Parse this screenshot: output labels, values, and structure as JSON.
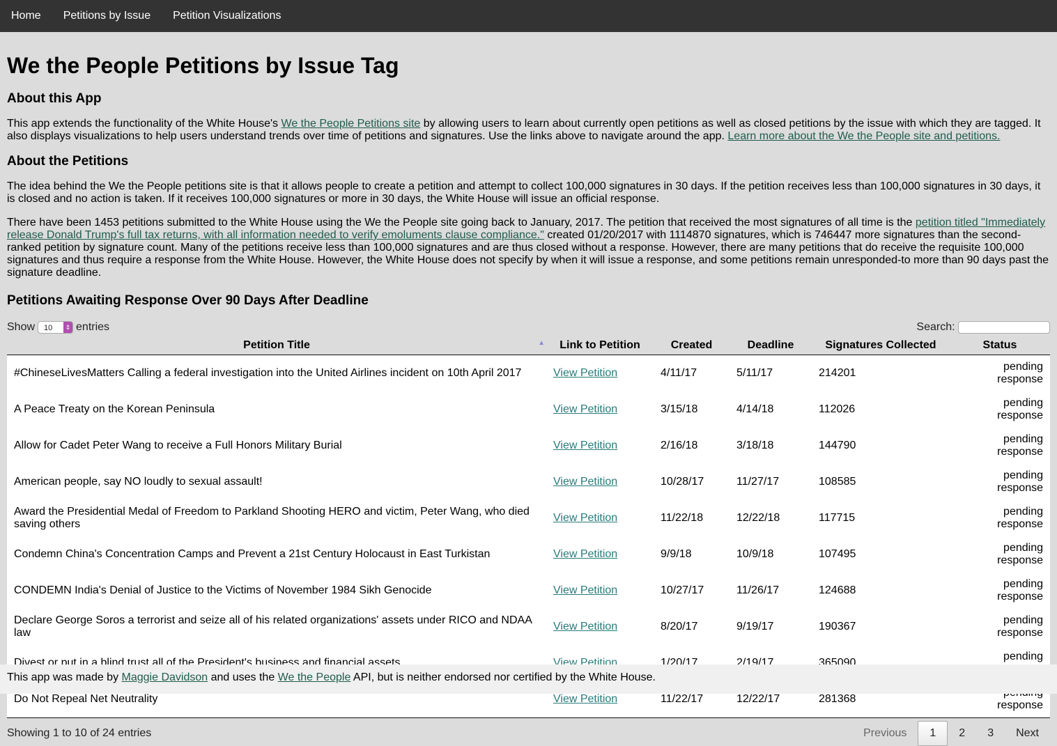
{
  "nav": [
    "Home",
    "Petitions by Issue",
    "Petition Visualizations"
  ],
  "title": "We the People Petitions by Issue Tag",
  "about_app": {
    "heading": "About this App",
    "t1": "This app extends the functionality of the White House's ",
    "link1": "We the People Petitions site",
    "t2": " by allowing users to learn about currently open petitions as well as closed petitions by the issue with which they are tagged. It also displays visualizations to help users understand trends over time of petitions and signatures. Use the links above to navigate around the app. ",
    "link2": "Learn more about the We the People site and petitions."
  },
  "about_petitions": {
    "heading": "About the Petitions",
    "p1": "The idea behind the We the People petitions site is that it allows people to create a petition and attempt to collect 100,000 signatures in 30 days. If the petition receives less than 100,000 signatures in 30 days, it is closed and no action is taken. If it receives 100,000 signatures or more in 30 days, the White House will issue an official response.",
    "p2a": "There have been 1453 petitions submitted to the White House using the We the People site going back to January, 2017. The petition that received the most signatures of all time is the ",
    "p2link": "petition titled \"Immediately release Donald Trump's full tax returns, with all information needed to verify emoluments clause compliance.\"",
    "p2b": " created 01/20/2017 with 1114870 signatures, which is 746447 more signatures than the second-ranked petition by signature count. Many of the petitions receive less than 100,000 signatures and are thus closed without a response. However, there are many petitions that do receive the requisite 100,000 signatures and thus require a response from the White House. However, the White House does not specify by when it will issue a response, and some petitions remain unresponded-to more than 90 days past the signature deadline."
  },
  "table_section": {
    "heading": "Petitions Awaiting Response Over 90 Days After Deadline",
    "show": "Show",
    "entries_value": "10",
    "entries": "entries",
    "search": "Search:",
    "search_value": "",
    "columns": [
      "Petition Title",
      "Link to Petition",
      "Created",
      "Deadline",
      "Signatures Collected",
      "Status"
    ],
    "rows": [
      [
        "#ChineseLivesMatters Calling a federal investigation into the United Airlines incident on 10th April 2017",
        "View Petition",
        "4/11/17",
        "5/11/17",
        "214201",
        "pending response"
      ],
      [
        "A Peace Treaty on the Korean Peninsula",
        "View Petition",
        "3/15/18",
        "4/14/18",
        "112026",
        "pending response"
      ],
      [
        "Allow for Cadet Peter Wang to receive a Full Honors Military Burial",
        "View Petition",
        "2/16/18",
        "3/18/18",
        "144790",
        "pending response"
      ],
      [
        "American people, say NO loudly to sexual assault!",
        "View Petition",
        "10/28/17",
        "11/27/17",
        "108585",
        "pending response"
      ],
      [
        "Award the Presidential Medal of Freedom to Parkland Shooting HERO and victim, Peter Wang, who died saving others",
        "View Petition",
        "11/22/18",
        "12/22/18",
        "117715",
        "pending response"
      ],
      [
        "Condemn China's Concentration Camps and Prevent a 21st Century Holocaust in East Turkistan",
        "View Petition",
        "9/9/18",
        "10/9/18",
        "107495",
        "pending response"
      ],
      [
        "CONDEMN India's Denial of Justice to the Victims of November 1984 Sikh Genocide",
        "View Petition",
        "10/27/17",
        "11/26/17",
        "124688",
        "pending response"
      ],
      [
        "Declare George Soros a terrorist and seize all of his related organizations' assets under RICO and NDAA law",
        "View Petition",
        "8/20/17",
        "9/19/17",
        "190367",
        "pending response"
      ],
      [
        "Divest or put in a blind trust all of the President's business and financial assets",
        "View Petition",
        "1/20/17",
        "2/19/17",
        "365090",
        "pending response"
      ],
      [
        "Do Not Repeal Net Neutrality",
        "View Petition",
        "11/22/17",
        "12/22/17",
        "281368",
        "pending response"
      ]
    ],
    "info": "Showing 1 to 10 of 24 entries",
    "pagination": {
      "previous": "Previous",
      "pages": [
        "1",
        "2",
        "3"
      ],
      "next": "Next"
    }
  },
  "footer": {
    "t1": "This app was made by ",
    "link1": "Maggie Davidson",
    "t2": " and uses the ",
    "link2": "We the People",
    "t3": " API, but is neither endorsed nor certified by the White House."
  }
}
